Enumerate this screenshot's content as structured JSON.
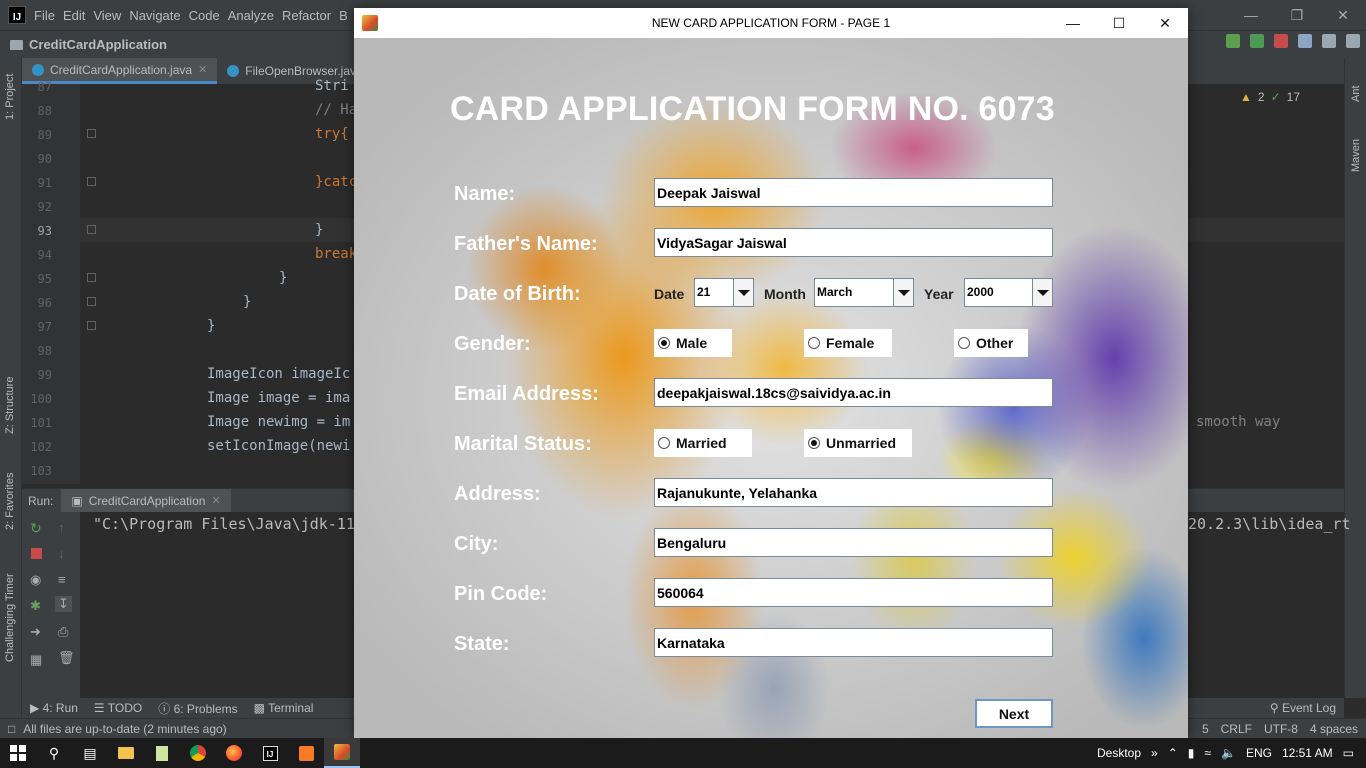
{
  "ide": {
    "menu": [
      "File",
      "Edit",
      "View",
      "Navigate",
      "Code",
      "Analyze",
      "Refactor",
      "B"
    ],
    "project_name": "CreditCardApplication",
    "tabs": [
      {
        "label": "CreditCardApplication.java",
        "active": true
      },
      {
        "label": "FileOpenBrowser.java",
        "active": false
      }
    ],
    "line_numbers": [
      "87",
      "88",
      "89",
      "90",
      "91",
      "92",
      "93",
      "94",
      "95",
      "96",
      "97",
      "98",
      "99",
      "100",
      "101",
      "102",
      "103"
    ],
    "code_lines": [
      "Stri",
      "// Ha",
      "try{",
      "",
      "}catc",
      "",
      "}",
      "break",
      "}",
      "}",
      "}",
      "",
      "ImageIcon imageIc",
      "Image image = ima",
      "Image newimg = im",
      "setIconImage(newi",
      ""
    ],
    "code_right_fragment": "smooth way",
    "inspections": {
      "warnings": "2",
      "weak_warnings": "17"
    },
    "left_strip_labels": [
      "1: Project",
      "Z: Structure",
      "2: Favorites",
      "Challenging Timer"
    ],
    "right_strip_labels": [
      "Ant",
      "Maven"
    ],
    "run_label": "Run:",
    "run_tab": "CreditCardApplication",
    "console_left": "\"C:\\Program Files\\Java\\jdk-11",
    "console_right": "20.2.3\\lib\\idea_rt",
    "bottom_tabs": [
      "4: Run",
      "TODO",
      "6: Problems",
      "Terminal"
    ],
    "event_log": "Event Log",
    "status_message": "All files are up-to-date (2 minutes ago)",
    "status_right": [
      "5",
      "CRLF",
      "UTF-8",
      "4 spaces"
    ]
  },
  "dialog": {
    "title": "NEW CARD APPLICATION FORM - PAGE 1",
    "heading": "CARD APPLICATION FORM NO. 6073",
    "labels": {
      "name": "Name:",
      "father": "Father's Name:",
      "dob": "Date of Birth:",
      "gender": "Gender:",
      "email": "Email Address:",
      "marital": "Marital Status:",
      "address": "Address:",
      "city": "City:",
      "pin": "Pin Code:",
      "state": "State:"
    },
    "values": {
      "name": "Deepak Jaiswal",
      "father": "VidyaSagar Jaiswal",
      "email": "deepakjaiswal.18cs@saividya.ac.in",
      "address": "Rajanukunte, Yelahanka",
      "city": "Bengaluru",
      "pin": "560064",
      "state": "Karnataka"
    },
    "dob": {
      "date_label": "Date",
      "date": "21",
      "month_label": "Month",
      "month": "March",
      "year_label": "Year",
      "year": "2000"
    },
    "gender_options": [
      {
        "label": "Male",
        "selected": true
      },
      {
        "label": "Female",
        "selected": false
      },
      {
        "label": "Other",
        "selected": false
      }
    ],
    "marital_options": [
      {
        "label": "Married",
        "selected": false
      },
      {
        "label": "Unmarried",
        "selected": true
      }
    ],
    "next_label": "Next"
  },
  "taskbar": {
    "desktop_label": "Desktop",
    "language": "ENG",
    "time": "12:51 AM"
  }
}
